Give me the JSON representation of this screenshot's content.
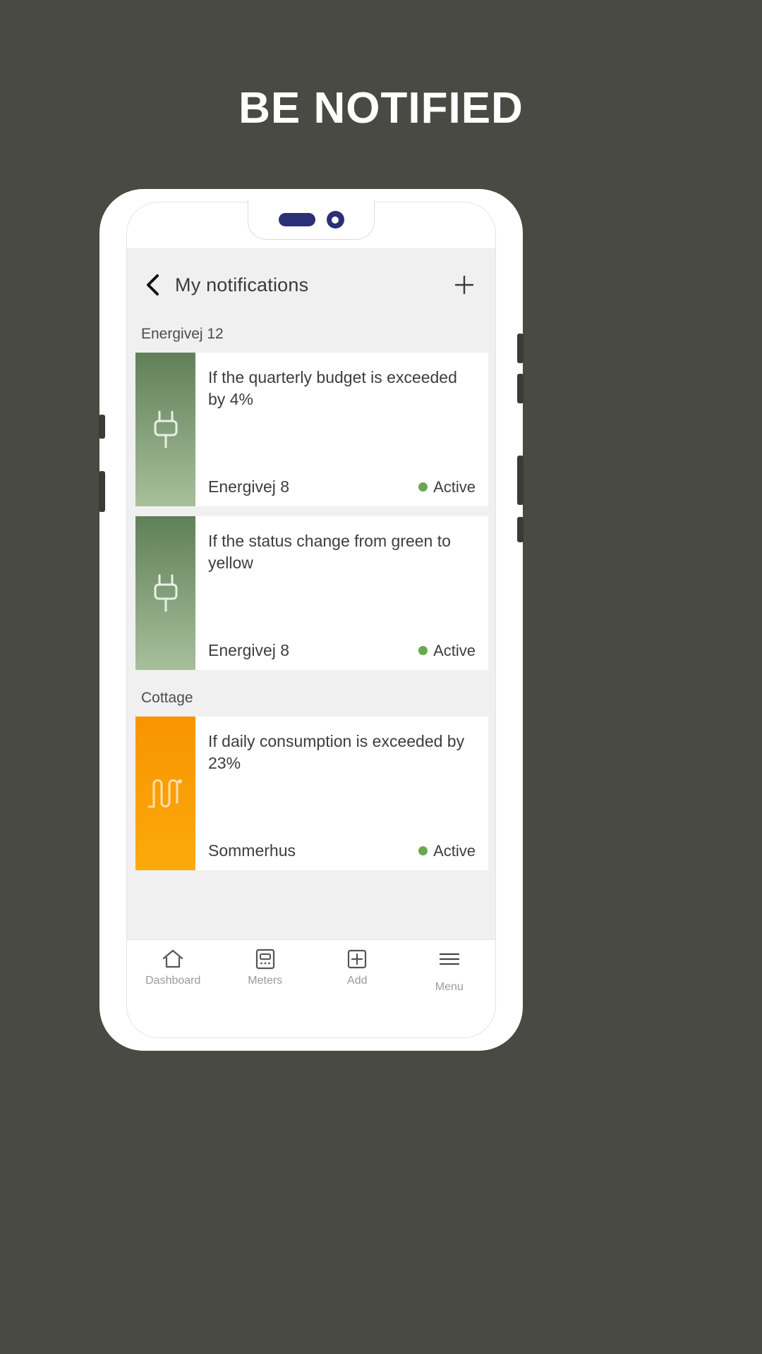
{
  "headline": "BE NOTIFIED",
  "phone": {
    "notch": {
      "speaker": "speaker-pill",
      "camera": "front-camera"
    }
  },
  "app": {
    "header": {
      "back_icon": "chevron-left-icon",
      "title": "My notifications",
      "add_icon": "plus-icon"
    },
    "sections": [
      {
        "label": "Energivej 12",
        "cards": [
          {
            "thumb_style": "green",
            "thumb_icon": "power-plug-icon",
            "text": "If the quarterly budget is exceeded by 4%",
            "meter": "Energivej 8",
            "status": "Active",
            "status_color": "#6aa84f"
          },
          {
            "thumb_style": "green",
            "thumb_icon": "power-plug-icon",
            "text": "If the status change from green to yellow",
            "meter": "Energivej 8",
            "status": "Active",
            "status_color": "#6aa84f"
          }
        ]
      },
      {
        "label": "Cottage",
        "cards": [
          {
            "thumb_style": "orange",
            "thumb_icon": "heating-coil-icon",
            "text": "If daily consumption is exceeded by 23%",
            "meter": "Sommerhus",
            "status": "Active",
            "status_color": "#6aa84f"
          }
        ]
      }
    ],
    "bottom_nav": [
      {
        "label": "Dashboard",
        "icon": "home-icon"
      },
      {
        "label": "Meters",
        "icon": "meter-icon"
      },
      {
        "label": "Add",
        "icon": "plus-box-icon"
      },
      {
        "label": "Menu",
        "icon": "hamburger-icon"
      }
    ]
  },
  "colors": {
    "page_background": "#4a4a44",
    "screen_background": "#f0f0f0",
    "card_background": "#ffffff",
    "accent_navy": "#2b2f76",
    "green_thumb_top": "#5f8059",
    "green_thumb_bottom": "#a8bf9c",
    "orange_thumb_top": "#f79500",
    "orange_thumb_bottom": "#fca90b",
    "status_green": "#6aa84f"
  }
}
